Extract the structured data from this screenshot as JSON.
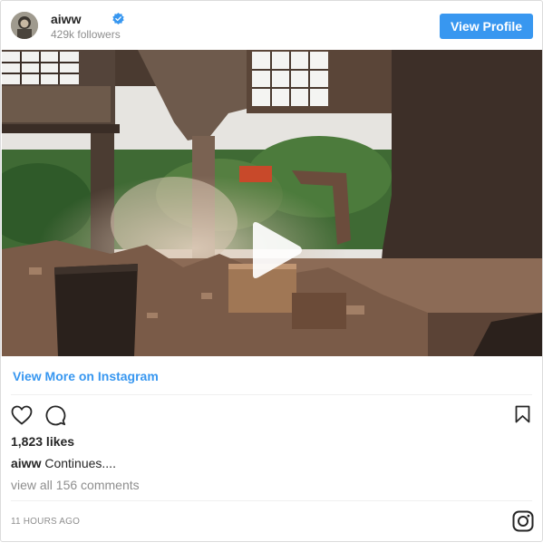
{
  "header": {
    "username": "aiww",
    "followers": "429k followers",
    "view_profile_label": "View Profile"
  },
  "media": {
    "type": "video",
    "play_icon": "play-icon"
  },
  "view_more_label": "View More on Instagram",
  "actions": {
    "like_icon": "heart-icon",
    "comment_icon": "comment-icon",
    "save_icon": "bookmark-icon"
  },
  "likes": "1,823 likes",
  "caption": {
    "user": "aiww",
    "text": "Continues...."
  },
  "comments_link": "view all 156 comments",
  "timestamp": "11 HOURS AGO",
  "footer_icon": "instagram-logo-icon",
  "colors": {
    "accent": "#3897f0",
    "text": "#262626",
    "muted": "#8e8e8e",
    "border": "#dbdbdb"
  }
}
